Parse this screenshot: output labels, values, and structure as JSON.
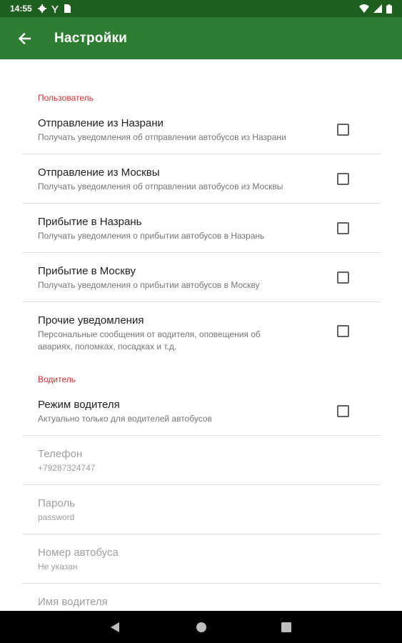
{
  "status_bar": {
    "time": "14:55",
    "icons_left": [
      "settings-icon",
      "signal-icon",
      "sim-card-icon"
    ],
    "icons_right": [
      "wifi-icon",
      "cell-signal-icon",
      "battery-icon"
    ]
  },
  "app_bar": {
    "title": "Настройки",
    "back_icon": "arrow-back-icon",
    "color": "#2e7d32"
  },
  "categories": {
    "user": "Пользователь",
    "driver": "Водитель",
    "accent_color": "#d32f2f"
  },
  "user_prefs": [
    {
      "title": "Отправление из Назрани",
      "summary": "Получать уведомления об отправлении автобусов из Назрани",
      "checked": false
    },
    {
      "title": "Отправление из Москвы",
      "summary": "Получать уведомления об отправлении автобусов из Москвы",
      "checked": false
    },
    {
      "title": "Прибытие в Назрань",
      "summary": "Получать уведомления о прибытии автобусов в Назрань",
      "checked": false
    },
    {
      "title": "Прибытие в Москву",
      "summary": "Получать уведомления о прибытии автобусов в Москву",
      "checked": false
    },
    {
      "title": "Прочие уведомления",
      "summary": "Персональные сообщения от водителя, оповещения об авариях, поломках, посадках и т.д.",
      "checked": false
    }
  ],
  "driver_prefs": {
    "driver_mode": {
      "title": "Режим водителя",
      "summary": "Актуально только для водителей автобусов",
      "checked": false
    },
    "phone": {
      "title": "Телефон",
      "summary": "+79287324747"
    },
    "password": {
      "title": "Пароль",
      "summary": "password"
    },
    "bus_number": {
      "title": "Номер автобуса",
      "summary": "Не указан"
    },
    "driver_name": {
      "title": "Имя водителя"
    }
  },
  "nav_bar": {
    "buttons": [
      "back-triangle-icon",
      "home-circle-icon",
      "recents-square-icon"
    ]
  }
}
